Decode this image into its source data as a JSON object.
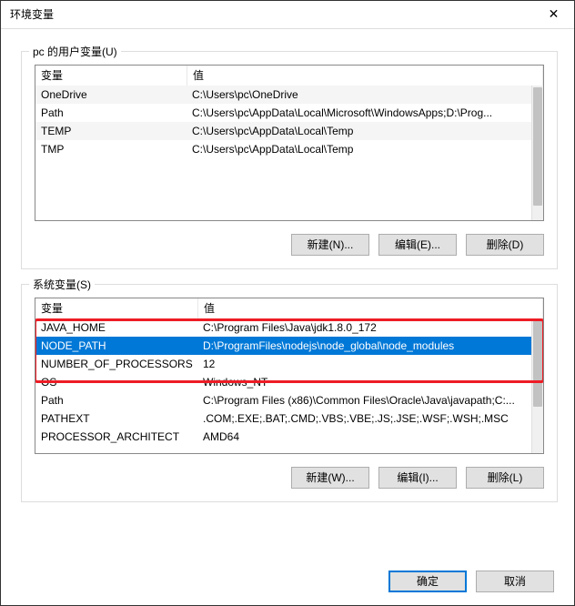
{
  "window_title": "环境变量",
  "user_group_title": "pc 的用户变量(U)",
  "system_group_title": "系统变量(S)",
  "col_name_header": "变量",
  "col_value_header": "值",
  "user_rows": [
    {
      "name": "OneDrive",
      "value": "C:\\Users\\pc\\OneDrive"
    },
    {
      "name": "Path",
      "value": "C:\\Users\\pc\\AppData\\Local\\Microsoft\\WindowsApps;D:\\Prog..."
    },
    {
      "name": "TEMP",
      "value": "C:\\Users\\pc\\AppData\\Local\\Temp"
    },
    {
      "name": "TMP",
      "value": "C:\\Users\\pc\\AppData\\Local\\Temp"
    }
  ],
  "system_rows": [
    {
      "name": "JAVA_HOME",
      "value": "C:\\Program Files\\Java\\jdk1.8.0_172"
    },
    {
      "name": "NODE_PATH",
      "value": "D:\\ProgramFiles\\nodejs\\node_global\\node_modules"
    },
    {
      "name": "NUMBER_OF_PROCESSORS",
      "value": "12"
    },
    {
      "name": "OS",
      "value": "Windows_NT"
    },
    {
      "name": "Path",
      "value": "C:\\Program Files (x86)\\Common Files\\Oracle\\Java\\javapath;C:..."
    },
    {
      "name": "PATHEXT",
      "value": ".COM;.EXE;.BAT;.CMD;.VBS;.VBE;.JS;.JSE;.WSF;.WSH;.MSC"
    },
    {
      "name": "PROCESSOR_ARCHITECT",
      "value": "AMD64"
    }
  ],
  "system_selected_index": 1,
  "buttons": {
    "new_user": "新建(N)...",
    "edit_user": "编辑(E)...",
    "delete_user": "删除(D)",
    "new_sys": "新建(W)...",
    "edit_sys": "编辑(I)...",
    "delete_sys": "删除(L)",
    "ok": "确定",
    "cancel": "取消"
  }
}
